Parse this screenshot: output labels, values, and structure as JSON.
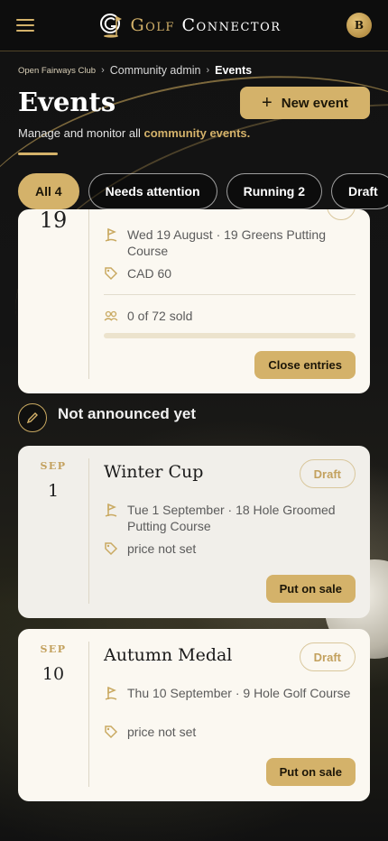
{
  "header": {
    "brand_first": "Golf",
    "brand_second": "Connector",
    "avatar_initial": "B"
  },
  "breadcrumb": {
    "club": "Open Fairways Club",
    "admin": "Community admin",
    "current": "Events"
  },
  "page": {
    "title": "Events",
    "subtitle_prefix": "Manage and monitor all",
    "subtitle_link": "community events.",
    "new_event_label": "New event"
  },
  "filters": [
    {
      "label": "All 4",
      "active": true
    },
    {
      "label": "Needs attention",
      "active": false
    },
    {
      "label": "Running 2",
      "active": false
    },
    {
      "label": "Draft",
      "active": false
    }
  ],
  "partial_event": {
    "day": "19",
    "venue": "Wed 19 August · 19 Greens Putting Course",
    "price": "CAD 60",
    "sold": "0 of 72 sold",
    "sold_fraction": 0,
    "action": "Close entries"
  },
  "section": {
    "title": "Not announced yet"
  },
  "draft_events": [
    {
      "month": "SEP",
      "day": "1",
      "title": "Winter Cup",
      "status": "Draft",
      "venue": "Tue 1 September · 18 Hole Groomed Putting Course",
      "price": "price not set",
      "action": "Put on sale"
    },
    {
      "month": "SEP",
      "day": "10",
      "title": "Autumn Medal",
      "status": "Draft",
      "venue": "Thu 10 September · 9 Hole Golf Course",
      "price": "price not set",
      "action": "Put on sale"
    }
  ],
  "colors": {
    "accent": "#d4b26a",
    "card": "#fbf8f1",
    "background": "#0f0f0f"
  }
}
